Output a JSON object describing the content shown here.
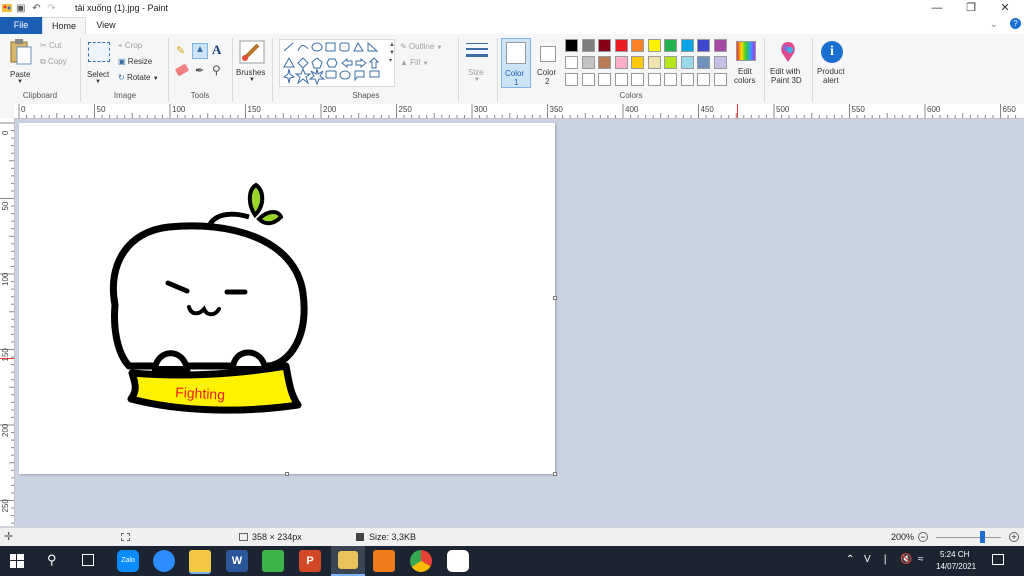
{
  "window": {
    "title": "tải xuống (1).jpg - Paint",
    "minimize_icon": "minimize-icon",
    "restore_icon": "restore-icon",
    "close_icon": "close-icon"
  },
  "tabs": {
    "file": "File",
    "home": "Home",
    "view": "View"
  },
  "ribbon": {
    "clipboard": {
      "paste": "Paste",
      "cut": "Cut",
      "copy": "Copy",
      "group": "Clipboard"
    },
    "image": {
      "select": "Select",
      "crop": "Crop",
      "resize": "Resize",
      "rotate": "Rotate",
      "group": "Image"
    },
    "tools": {
      "group": "Tools"
    },
    "brushes": {
      "label": "Brushes"
    },
    "shapes": {
      "outline": "Outline",
      "fill": "Fill",
      "group": "Shapes"
    },
    "size": {
      "label": "Size"
    },
    "color1": {
      "label": "Color",
      "num": "1",
      "value": "#ffffff"
    },
    "color2": {
      "label": "Color",
      "num": "2",
      "value": "#ffffff"
    },
    "colors": {
      "group": "Colors",
      "palette_row1": [
        "#000000",
        "#7f7f7f",
        "#880015",
        "#ed1c24",
        "#ff7f27",
        "#fff200",
        "#22b14c",
        "#00a2e8",
        "#3f48cc",
        "#a349a4"
      ],
      "palette_row2": [
        "#ffffff",
        "#c3c3c3",
        "#b97a57",
        "#ffaec9",
        "#ffc90e",
        "#efe4b0",
        "#b5e61d",
        "#99d9ea",
        "#7092be",
        "#c8bfe7"
      ],
      "palette_row3": [
        "#ffffff",
        "#ffffff",
        "#ffffff",
        "#ffffff",
        "#ffffff",
        "#ffffff",
        "#ffffff",
        "#ffffff",
        "#ffffff",
        "#ffffff"
      ],
      "edit_line1": "Edit",
      "edit_line2": "colors"
    },
    "paint3d": {
      "line1": "Edit with",
      "line2": "Paint 3D"
    },
    "product_alert": {
      "line1": "Product",
      "line2": "alert"
    }
  },
  "ruler": {
    "top_ticks": [
      "0",
      "50",
      "100",
      "150",
      "200",
      "250",
      "300",
      "350",
      "400",
      "450",
      "500",
      "550",
      "600",
      "650"
    ],
    "left_ticks": [
      "0",
      "50",
      "100",
      "150",
      "200",
      "250"
    ]
  },
  "drawing": {
    "banner_text": "Fighting"
  },
  "status": {
    "dimensions": "358 × 234px",
    "size": "Size: 3,3KB",
    "zoom": "200%",
    "zoom_level": 0.7
  },
  "taskbar": {
    "time": "5:24 CH",
    "date": "14/07/2021",
    "lang": "V",
    "zalo_label": "Zalo"
  }
}
